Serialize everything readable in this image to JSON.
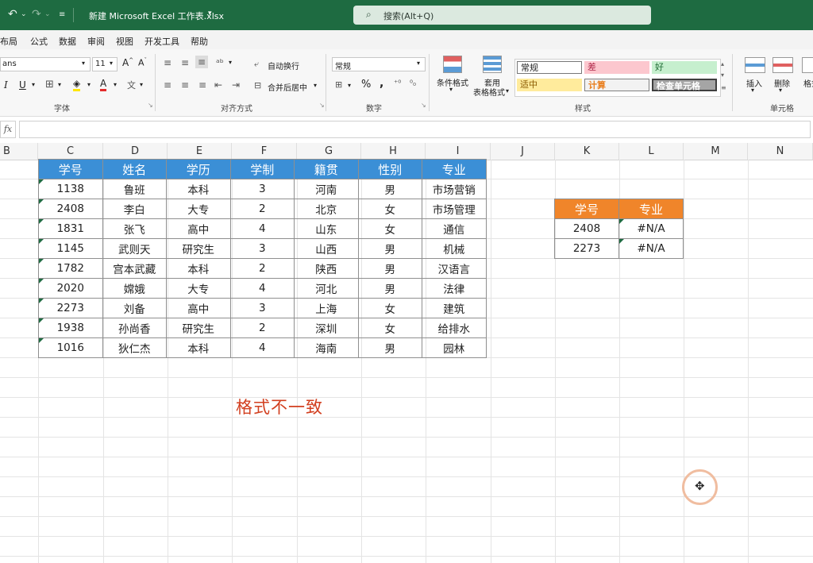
{
  "window": {
    "title": "新建 Microsoft Excel 工作表.xlsx",
    "search_placeholder": "搜索(Alt+Q)"
  },
  "menu": [
    "布局",
    "公式",
    "数据",
    "审阅",
    "视图",
    "开发工具",
    "帮助"
  ],
  "ribbon": {
    "font_name": "ans",
    "font_size": "11",
    "wrap_text": "自动换行",
    "merge_center": "合并后居中",
    "number_format": "常规",
    "conditional_format": "条件格式",
    "table_format_line1": "套用",
    "table_format_line2": "表格格式",
    "insert": "插入",
    "delete": "删除",
    "format_partial": "格式",
    "groups": {
      "font": "字体",
      "alignment": "对齐方式",
      "number": "数字",
      "styles": "样式",
      "cells": "单元格"
    },
    "styles": {
      "normal": "常规",
      "bad": "差",
      "good": "好",
      "neutral": "适中",
      "calculation": "计算",
      "check_cell": "检查单元格"
    },
    "colors": {
      "bad_bg": "#fcc7ce",
      "good_bg": "#c6efce",
      "neutral_bg": "#ffeb9c",
      "calc_bg": "#f2f2f2",
      "check_bg": "#a5a5a5"
    }
  },
  "formula_bar": {
    "fx": "fx",
    "value": ""
  },
  "columns": [
    "B",
    "C",
    "D",
    "E",
    "F",
    "G",
    "H",
    "I",
    "J",
    "K",
    "L",
    "M",
    "N"
  ],
  "main_table": {
    "headers": [
      "学号",
      "姓名",
      "学历",
      "学制",
      "籍贯",
      "性别",
      "专业"
    ],
    "rows": [
      [
        "1138",
        "鲁班",
        "本科",
        "3",
        "河南",
        "男",
        "市场营销"
      ],
      [
        "2408",
        "李白",
        "大专",
        "2",
        "北京",
        "女",
        "市场管理"
      ],
      [
        "1831",
        "张飞",
        "高中",
        "4",
        "山东",
        "女",
        "通信"
      ],
      [
        "1145",
        "武则天",
        "研究生",
        "3",
        "山西",
        "男",
        "机械"
      ],
      [
        "1782",
        "宫本武藏",
        "本科",
        "2",
        "陕西",
        "男",
        "汉语言"
      ],
      [
        "2020",
        "嫦娥",
        "大专",
        "4",
        "河北",
        "男",
        "法律"
      ],
      [
        "2273",
        "刘备",
        "高中",
        "3",
        "上海",
        "女",
        "建筑"
      ],
      [
        "1938",
        "孙尚香",
        "研究生",
        "2",
        "深圳",
        "女",
        "给排水"
      ],
      [
        "1016",
        "狄仁杰",
        "本科",
        "4",
        "海南",
        "男",
        "园林"
      ]
    ],
    "header_color": "#3b8fd6"
  },
  "lookup_table": {
    "headers": [
      "学号",
      "专业"
    ],
    "rows": [
      [
        "2408",
        "#N/A"
      ],
      [
        "2273",
        "#N/A"
      ]
    ],
    "header_color": "#f0852a"
  },
  "annotation": "格式不一致"
}
